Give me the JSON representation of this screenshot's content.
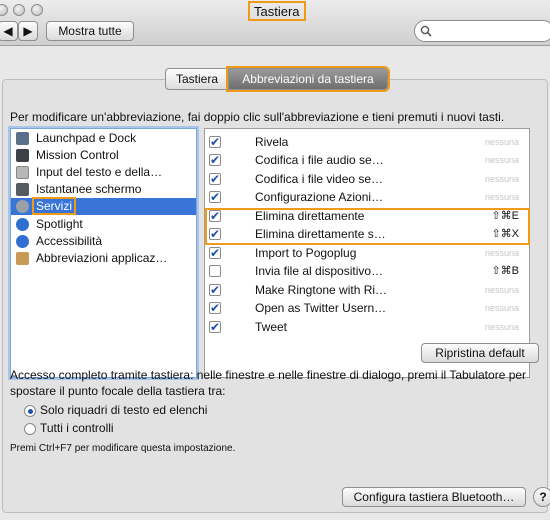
{
  "window": {
    "title": "Tastiera",
    "show_all_label": "Mostra tutte",
    "search_placeholder": ""
  },
  "tabs": [
    {
      "label": "Tastiera",
      "active": false
    },
    {
      "label": "Abbreviazioni da tastiera",
      "active": true
    }
  ],
  "instructions": "Per modificare un'abbreviazione, fai doppio clic sull'abbreviazione e tieni premuti i nuovi tasti.",
  "categories": [
    {
      "label": "Launchpad e Dock",
      "icon": "launchpad-dock-icon",
      "color": "#5a6f8a"
    },
    {
      "label": "Mission Control",
      "icon": "mission-control-icon",
      "color": "#3b3f46"
    },
    {
      "label": "Input del testo e della…",
      "icon": "keyboard-icon",
      "color": "#b8b8b8"
    },
    {
      "label": "Istantanee schermo",
      "icon": "screenshot-icon",
      "color": "#555b63"
    },
    {
      "label": "Servizi",
      "icon": "gear-icon",
      "color": "#9aa0a8",
      "selected": true
    },
    {
      "label": "Spotlight",
      "icon": "spotlight-icon",
      "color": "#2f6fd1"
    },
    {
      "label": "Accessibilità",
      "icon": "accessibility-icon",
      "color": "#2f6fd1"
    },
    {
      "label": "Abbreviazioni applicaz…",
      "icon": "app-shortcuts-icon",
      "color": "#c79b55"
    }
  ],
  "shortcuts": [
    {
      "name": "Rivela",
      "checked": true,
      "key": "nessuna",
      "none": true
    },
    {
      "name": "Codifica i file audio se…",
      "checked": true,
      "key": "nessuna",
      "none": true
    },
    {
      "name": "Codifica i file video se…",
      "checked": true,
      "key": "nessuna",
      "none": true
    },
    {
      "name": "Configurazione Azioni…",
      "checked": true,
      "key": "nessuna",
      "none": true
    },
    {
      "name": "Elimina direttamente",
      "checked": true,
      "key": "⇧⌘E",
      "none": false
    },
    {
      "name": "Elimina direttamente s…",
      "checked": true,
      "key": "⇧⌘X",
      "none": false
    },
    {
      "name": "Import to Pogoplug",
      "checked": true,
      "key": "nessuna",
      "none": true
    },
    {
      "name": "Invia file al dispositivo…",
      "checked": false,
      "key": "⇧⌘B",
      "none": false
    },
    {
      "name": "Make Ringtone with Ri…",
      "checked": true,
      "key": "nessuna",
      "none": true
    },
    {
      "name": "Open as Twitter Usern…",
      "checked": true,
      "key": "nessuna",
      "none": true
    },
    {
      "name": "Tweet",
      "checked": true,
      "key": "nessuna",
      "none": true
    }
  ],
  "restore_default_label": "Ripristina default",
  "full_access_text": "Accesso completo tramite tastiera: nelle finestre e nelle finestre di dialogo, premi il Tabulatore per spostare il punto focale della tastiera tra:",
  "radio_options": [
    {
      "label": "Solo riquadri di testo ed elenchi",
      "selected": true
    },
    {
      "label": "Tutti i controlli",
      "selected": false
    }
  ],
  "note": "Premi Ctrl+F7 per modificare questa impostazione.",
  "bluetooth_button_label": "Configura tastiera Bluetooth…",
  "help_label": "?",
  "accent_color": "#f09a1a",
  "selection_color": "#3875d7"
}
